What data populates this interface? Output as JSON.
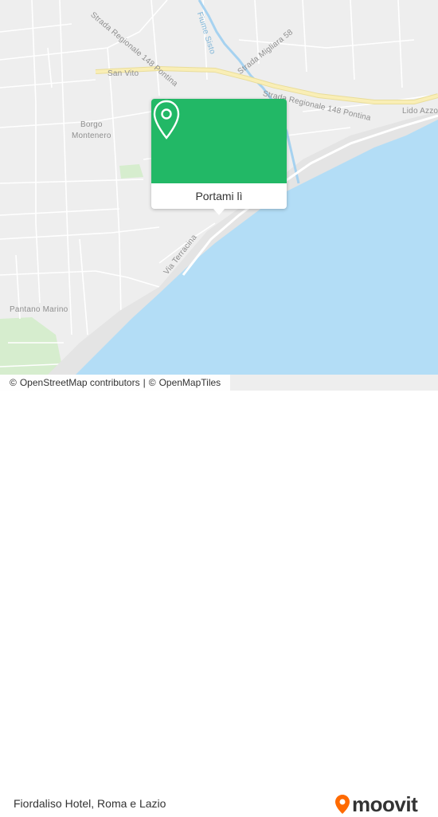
{
  "map": {
    "labels": {
      "strada_regionale_1": "Strada Regionale 148 Pontina",
      "strada_regionale_2": "Strada Regionale 148 Pontina",
      "strada_migliara": "Strada Migliara 58",
      "fiume_sisto": "Fiume Sisto",
      "san_vito": "San Vito",
      "borgo_montenero": "Borgo\nMontenero",
      "lido_azzo": "Lido Azzo",
      "via_terracina": "Via Terracina",
      "pantano_marino": "Pantano Marino"
    },
    "colors": {
      "land": "#eeeeee",
      "sea": "#b3ddf6",
      "main_road": "#f9eeb6",
      "road": "#ffffff",
      "river": "#a6d2f0",
      "green": "#d6edce"
    }
  },
  "popup": {
    "button_label": "Portami lì",
    "accent": "#22b866",
    "icon": "location-pin-icon"
  },
  "attribution": {
    "prefix": "©",
    "osm_contributors": "OpenStreetMap contributors",
    "separator": "|",
    "prefix2": "©",
    "openmaptiles": "OpenMapTiles"
  },
  "footer": {
    "place": "Fiordaliso Hotel, Roma e Lazio",
    "brand": "moovit",
    "brand_color": "#ff6a00"
  }
}
